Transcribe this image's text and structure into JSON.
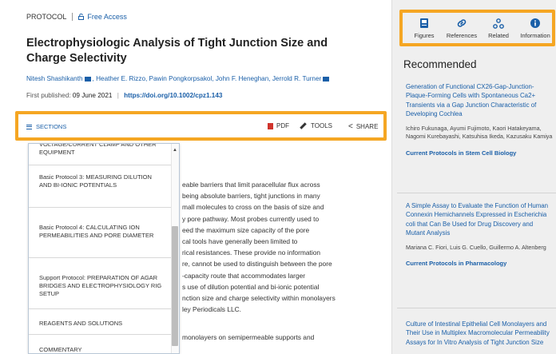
{
  "article": {
    "type_label": "PROTOCOL",
    "access_label": "Free Access",
    "title": "Electrophysiologic Analysis of Tight Junction Size and Charge Selectivity",
    "authors": [
      "Nitesh Shashikanth",
      "Heather E. Rizzo, Pawin Pongkorpsakol, John F. Heneghan, Jerrold R. Turner"
    ],
    "published_label": "First published:",
    "published_date": "09 June 2021",
    "doi": "https://doi.org/10.1002/cpz1.143"
  },
  "toolbar": {
    "sections_label": "SECTIONS",
    "pdf_label": "PDF",
    "tools_label": "TOOLS",
    "share_label": "SHARE"
  },
  "sections_menu": {
    "items": [
      "VOLTAGE/CURRENT CLAMP AND OTHER EQUIPMENT",
      "Basic Protocol 3: MEASURING DILUTION AND BI-IONIC POTENTIALS",
      "Basic Protocol 4: CALCULATING ION PERMEABILITIES AND PORE DIAMETER",
      "Support Protocol: PREPARATION OF AGAR BRIDGES AND ELECTROPHYSIOLOGY RIG SETUP",
      "REAGENTS AND SOLUTIONS",
      "COMMENTARY"
    ]
  },
  "abstract_lines": [
    "eable barriers that limit paracellular flux across",
    "being absolute barriers, tight junctions in many",
    "mall molecules to cross on the basis of size and",
    "y pore pathway. Most probes currently used to",
    "eed the maximum size capacity of the pore",
    "cal tools have generally been limited to",
    "rical resistances. These provide no information",
    "re, cannot be used to distinguish between the pore",
    "-capacity route that accommodates larger",
    "s use of dilution potential and bi-ionic potential",
    "nction size and charge selectivity within monolayers",
    "ley Periodicals LLC."
  ],
  "para2": "monolayers on semipermeable supports and",
  "side_tabs": [
    {
      "label": "Figures",
      "icon": "figures-icon"
    },
    {
      "label": "References",
      "icon": "link-icon"
    },
    {
      "label": "Related",
      "icon": "related-icon"
    },
    {
      "label": "Information",
      "icon": "info-icon"
    }
  ],
  "recommended": {
    "heading": "Recommended",
    "items": [
      {
        "title": "Generation of Functional CX26-Gap-Junction-Plaque-Forming Cells with Spontaneous Ca2+ Transients via a Gap Junction Characteristic of Developing Cochlea",
        "authors": "Ichiro Fukunaga, Ayumi Fujimoto, Kaori Hatakeyama, Nagomi Kurebayashi, Katsuhisa Ikeda, Kazusaku Kamiya",
        "journal": "Current Protocols in Stem Cell Biology"
      },
      {
        "title": "A Simple Assay to Evaluate the Function of Human Connexin Hemichannels Expressed in Escherichia coli that Can Be Used for Drug Discovery and Mutant Analysis",
        "authors": "Mariana C. Fiori, Luis G. Cuello, Guillermo A. Altenberg",
        "journal": "Current Protocols in Pharmacology"
      },
      {
        "title": "Culture of Intestinal Epithelial Cell Monolayers and Their Use in Multiplex Macromolecular Permeability Assays for In Vitro Analysis of Tight Junction Size"
      }
    ]
  },
  "colors": {
    "link": "#1a5fa8",
    "highlight": "#f5a623",
    "pdf": "#d0342c"
  }
}
